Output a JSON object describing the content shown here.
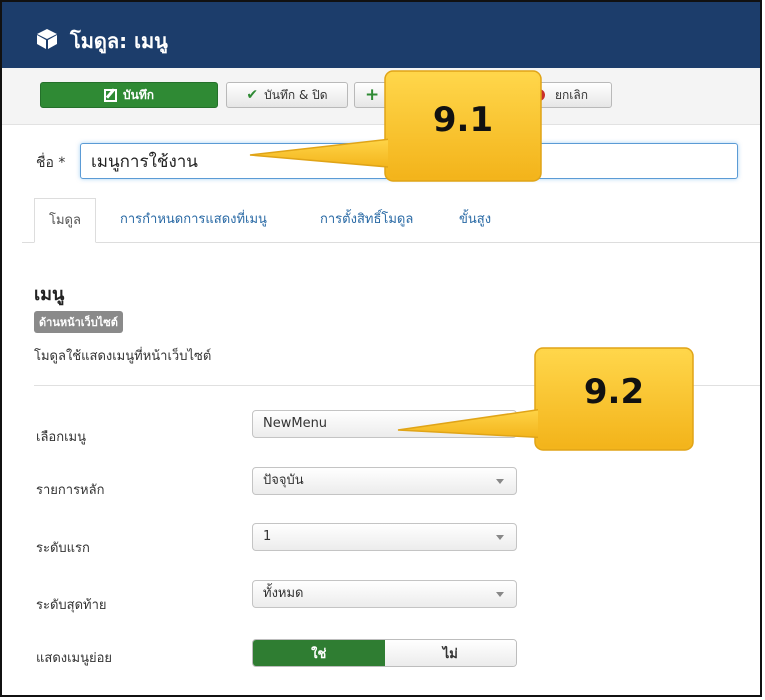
{
  "header": {
    "title": "โมดูล: เมนู",
    "icon": "cube-icon",
    "bg_color": "#1c3d6b"
  },
  "toolbar": {
    "save_label": "บันทึก",
    "save_close_label": "บันทึก & ปิด",
    "save_new_label": "",
    "cancel_label": "ยกเลิก",
    "save_color": "#2f8a34"
  },
  "form": {
    "name_label": "ชื่อ",
    "required_mark": "*",
    "name_value": "เมนูการใช้งาน"
  },
  "tabs": [
    {
      "label": "โมดูล",
      "active": true
    },
    {
      "label": "การกำหนดการแสดงที่เมนู"
    },
    {
      "label": "การตั้งสิทธิ์โมดูล"
    },
    {
      "label": "ขั้นสูง"
    }
  ],
  "module": {
    "title": "เมนู",
    "badge": "ด้านหน้าเว็บไซต์",
    "description": "โมดูลใช้แสดงเมนูที่หน้าเว็บไซต์"
  },
  "fields": {
    "select_menu": {
      "label": "เลือกเมนู",
      "value": "NewMenu"
    },
    "base_item": {
      "label": "รายการหลัก",
      "value": "ปัจจุบัน"
    },
    "start_level": {
      "label": "ระดับแรก",
      "value": "1"
    },
    "end_level": {
      "label": "ระดับสุดท้าย",
      "value": "ทั้งหมด"
    },
    "show_submenu": {
      "label": "แสดงเมนูย่อย",
      "yes_label": "ใช่",
      "no_label": "ไม่",
      "selected": "yes"
    }
  },
  "callouts": {
    "first": "9.1",
    "second": "9.2",
    "color": "#fbc02d"
  }
}
